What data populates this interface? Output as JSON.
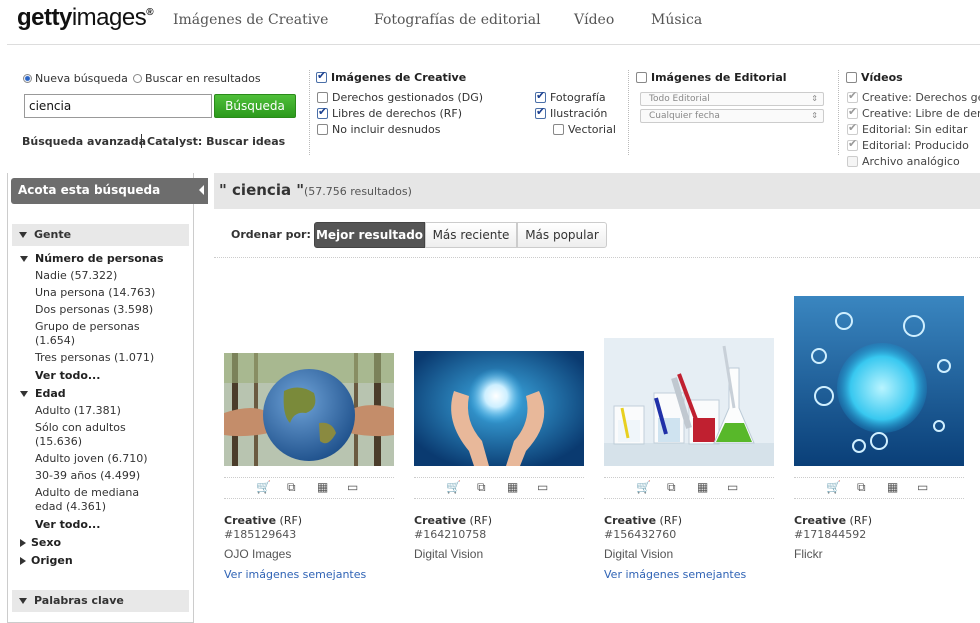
{
  "logo": {
    "part1": "getty",
    "part2": "images",
    "reg": "®"
  },
  "nav": [
    "Imágenes de Creative",
    "Fotografías de editorial",
    "Vídeo",
    "Música"
  ],
  "search": {
    "radio_new": "Nueva búsqueda",
    "radio_within": "Buscar en resultados",
    "value": "ciencia",
    "button": "Búsqueda",
    "advanced": "Búsqueda avanzada",
    "catalyst": "Catalyst: Buscar ideas"
  },
  "creative_filters": {
    "title": "Imágenes de Creative",
    "options": [
      "Derechos gestionados (DG)",
      "Libres de derechos (RF)",
      "No incluir desnudos"
    ],
    "types": [
      "Fotografía",
      "Ilustración",
      "Vectorial"
    ]
  },
  "editorial_filters": {
    "title": "Imágenes de Editorial",
    "select1": "Todo Editorial",
    "select2": "Cualquier fecha"
  },
  "video_filters": {
    "title": "Vídeos",
    "options": [
      "Creative: Derechos ge",
      "Creative: Libre de der",
      "Editorial: Sin editar",
      "Editorial: Producido",
      "Archivo analógico"
    ]
  },
  "sidebar": {
    "title": "Acota esta búsqueda",
    "gente": "Gente",
    "num_personas": "Número de personas",
    "num_items": [
      "Nadie (57.322)",
      "Una persona (14.763)",
      "Dos personas (3.598)",
      "Grupo de personas",
      "(1.654)",
      "Tres personas (1.071)"
    ],
    "ver_todo": "Ver todo...",
    "edad": "Edad",
    "edad_items": [
      "Adulto (17.381)",
      "Sólo con adultos",
      "(15.636)",
      "Adulto joven (6.710)",
      "30-39 años (4.499)",
      "Adulto de mediana",
      "edad (4.361)"
    ],
    "sexo": "Sexo",
    "origen": "Origen",
    "palabras": "Palabras clave"
  },
  "results": {
    "query": "\" ciencia \"",
    "count": "(57.756 resultados)",
    "sort_label": "Ordenar por:",
    "sort_options": [
      "Mejor resultado",
      "Más reciente",
      "Más popular"
    ]
  },
  "images": [
    {
      "type": "Creative",
      "license": "(RF)",
      "id": "#185129643",
      "source": "OJO Images",
      "similar": "Ver imágenes semejantes"
    },
    {
      "type": "Creative",
      "license": "(RF)",
      "id": "#164210758",
      "source": "Digital Vision",
      "similar": ""
    },
    {
      "type": "Creative",
      "license": "(RF)",
      "id": "#156432760",
      "source": "Digital Vision",
      "similar": "Ver imágenes semejantes"
    },
    {
      "type": "Creative",
      "license": "(RF)",
      "id": "#171844592",
      "source": "Flickr",
      "similar": ""
    }
  ]
}
